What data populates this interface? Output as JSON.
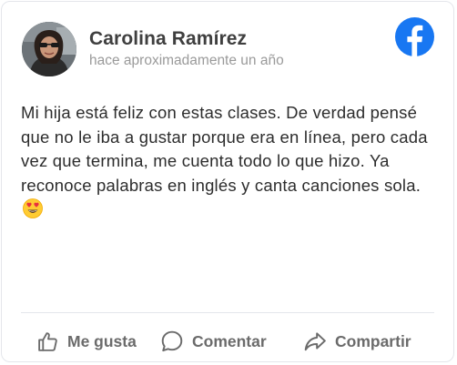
{
  "post": {
    "author_name": "Carolina Ramírez",
    "timestamp": "hace aproximadamente un año",
    "body": "Mi hija está feliz con estas clases. De verdad pensé que no le iba a gustar porque era en línea, pero cada vez que termina, me cuenta todo lo que hizo. Ya reconoce palabras en inglés y canta canciones sola.",
    "emoji": "heart-eyes-emoji"
  },
  "brand": {
    "icon": "facebook-icon",
    "color": "#1877f2"
  },
  "actions": {
    "like_label": "Me gusta",
    "comment_label": "Comentar",
    "share_label": "Compartir"
  },
  "icons": {
    "like": "thumbs-up-icon",
    "comment": "speech-bubble-icon",
    "share": "share-arrow-icon"
  },
  "colors": {
    "author_text": "#3f3f3f",
    "meta_text": "#9a9a9a",
    "body_text": "#2d2d2d",
    "action_text": "#6b6b6b",
    "divider": "#e4e6eb"
  }
}
